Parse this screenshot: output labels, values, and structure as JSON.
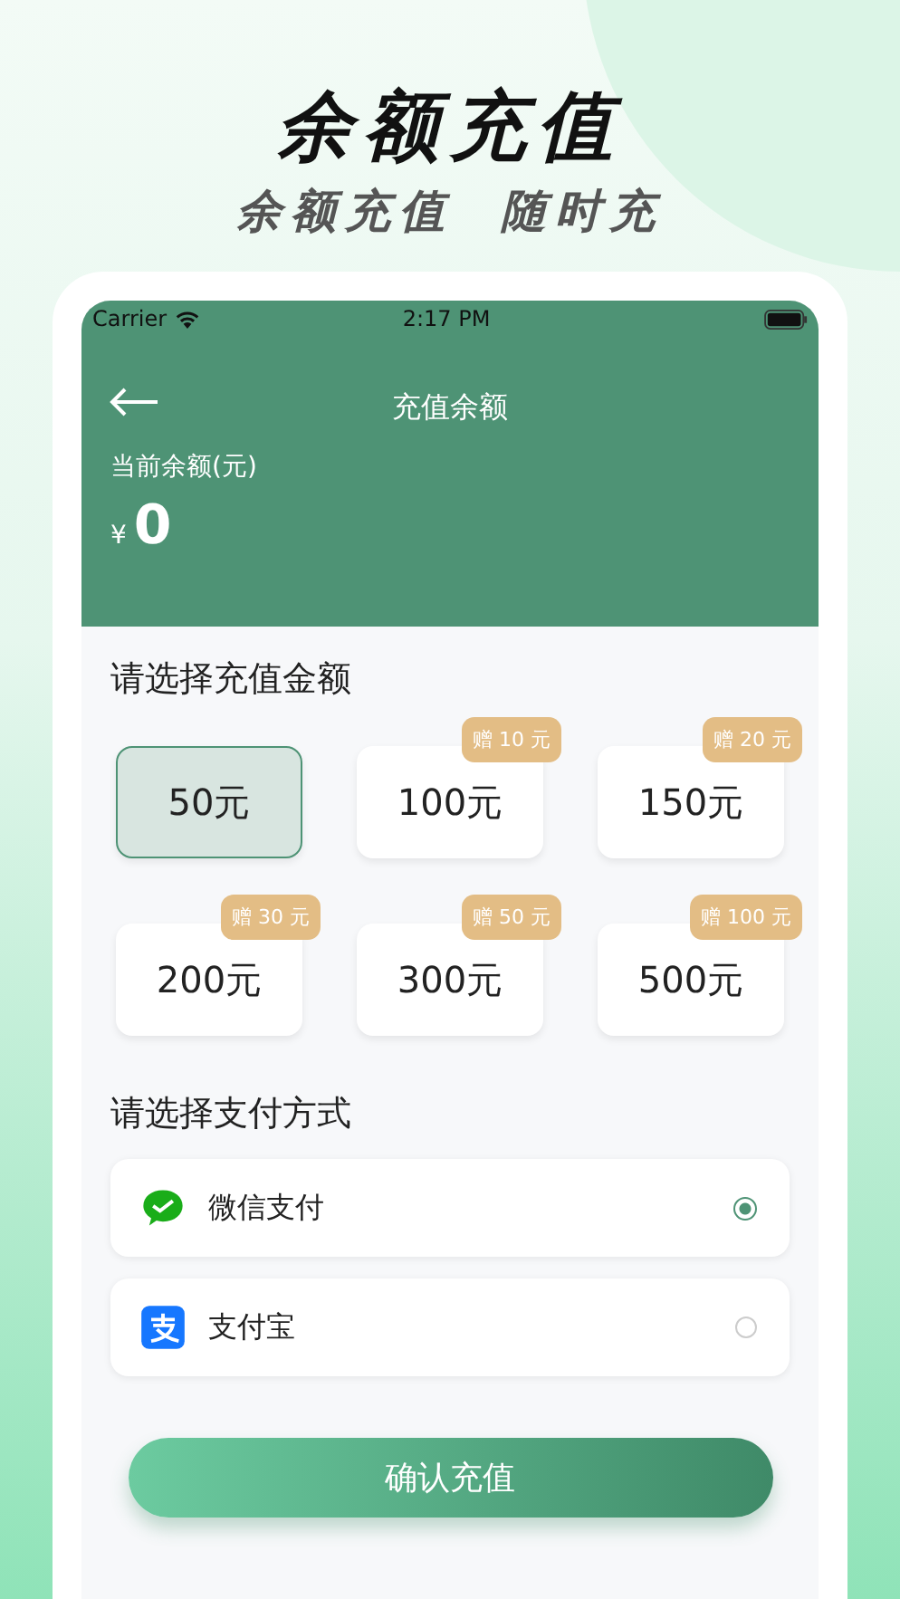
{
  "promo": {
    "headline": "余额充值",
    "tagline": [
      "余额充值",
      "随时充"
    ]
  },
  "status_bar": {
    "carrier": "Carrier",
    "time": "2:17 PM"
  },
  "nav": {
    "title": "充值余额"
  },
  "balance": {
    "label": "当前余额(元)",
    "currency": "¥",
    "amount": "0"
  },
  "amount_section": {
    "title": "请选择充值金额",
    "options": [
      {
        "label": "50元",
        "selected": true
      },
      {
        "label": "100元",
        "bonus": "赠 10 元",
        "selected": false
      },
      {
        "label": "150元",
        "bonus": "赠 20 元",
        "selected": false
      },
      {
        "label": "200元",
        "bonus": "赠 30 元",
        "selected": false
      },
      {
        "label": "300元",
        "bonus": "赠 50 元",
        "selected": false
      },
      {
        "label": "500元",
        "bonus": "赠 100 元",
        "selected": false
      }
    ]
  },
  "payment_section": {
    "title": "请选择支付方式",
    "methods": [
      {
        "kind": "wechat",
        "label": "微信支付",
        "selected": true
      },
      {
        "kind": "alipay",
        "label": "支付宝",
        "selected": false
      }
    ]
  },
  "confirm_button": "确认充值"
}
